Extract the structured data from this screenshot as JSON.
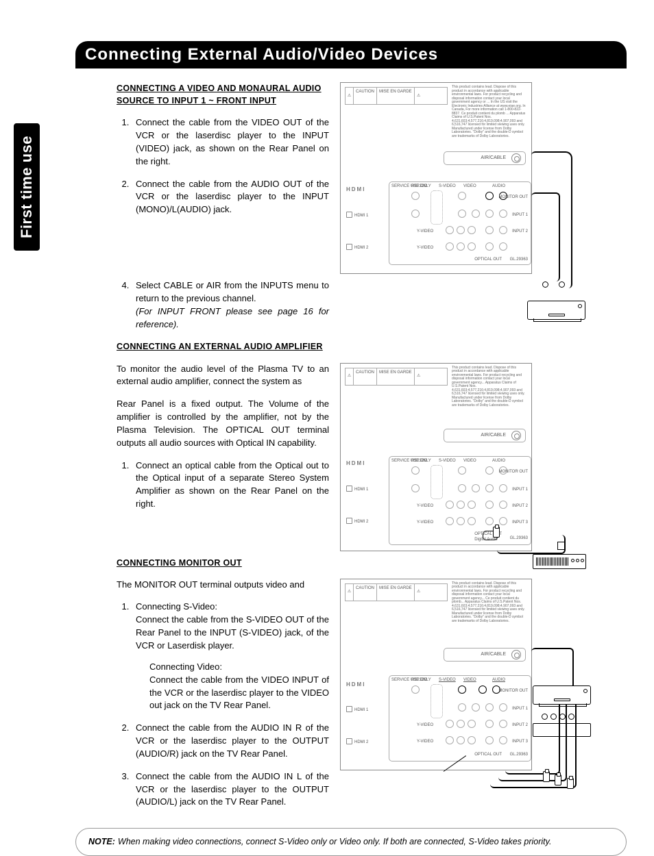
{
  "sideTab": "First time use",
  "pageTitle": "Connecting External Audio/Video Devices",
  "section1": {
    "heading": "CONNECTING A VIDEO AND MONAURAL AUDIO SOURCE TO INPUT 1  ~ FRONT INPUT",
    "steps": {
      "s1": "Connect the cable from the VIDEO OUT of the VCR or the laserdisc player to the INPUT (VIDEO) jack, as shown on the Rear Panel on the right.",
      "s2": "Connect the cable from the AUDIO OUT of the VCR or the laserdisc player to the INPUT (MONO)/L(AUDIO) jack.",
      "s4": "Select CABLE or AIR from the INPUTS menu to return to the previous channel.",
      "s4_note": "(For INPUT FRONT please see page 16 for reference)."
    }
  },
  "section2": {
    "heading": "CONNECTING AN EXTERNAL AUDIO AMPLIFIER",
    "p1": "To monitor the audio level of the Plasma TV to an external audio amplifier, connect the system as",
    "p2": "Rear Panel is a fixed output.  The Volume of the amplifier is controlled by the amplifier, not by the Plasma Television.  The OPTICAL OUT terminal outputs all audio sources with Optical IN capability.",
    "s1": "Connect an optical cable from the Optical out to the Optical input of a separate Stereo System Amplifier as shown on the Rear Panel on the right."
  },
  "section3": {
    "heading": "CONNECTING MONITOR OUT",
    "p1": "The MONITOR OUT terminal outputs video and",
    "s1a_title": "Connecting S-Video:",
    "s1a": "Connect the cable from the S-VIDEO OUT of the Rear Panel to the INPUT (S-VIDEO) jack, of the VCR or Laserdisk player.",
    "s1b_title": "Connecting Video:",
    "s1b": "Connect the cable from the VIDEO INPUT of the VCR or the laserdisc player to the VIDEO out jack on the TV Rear Panel.",
    "s2": "Connect the cable from the AUDIO IN R of the VCR or the laserdisc player to the OUTPUT (AUDIO/R) jack on the TV Rear Panel.",
    "s3": "Connect the cable from the AUDIO IN L of the VCR or the laserdisc player to the OUTPUT (AUDIO/L) jack on the TV Rear Panel."
  },
  "note": {
    "label": "NOTE:",
    "text": "When making video connections, connect S-Video only or Video only.  If both are connected, S-Video takes priority."
  },
  "diag": {
    "caution": "CAUTION",
    "mise": "MISE EN GARDE",
    "aircable": "AIR/CABLE",
    "hdmi": "HDMI",
    "hdmi1": "HDMI 1",
    "hdmi2": "HDMI 2",
    "service": "SERVICE USE ONLY",
    "rs232c": "RS232C",
    "svideo": "S-VIDEO",
    "video": "VIDEO",
    "audio": "AUDIO",
    "yvideo": "Y-VIDEO",
    "monitor": "MONITOR OUT",
    "input1": "INPUT 1",
    "input2": "INPUT 2",
    "input3": "INPUT 3",
    "optical": "OPTICAL OUT",
    "gl": "GL.29363",
    "digital": "Digital Audio"
  }
}
